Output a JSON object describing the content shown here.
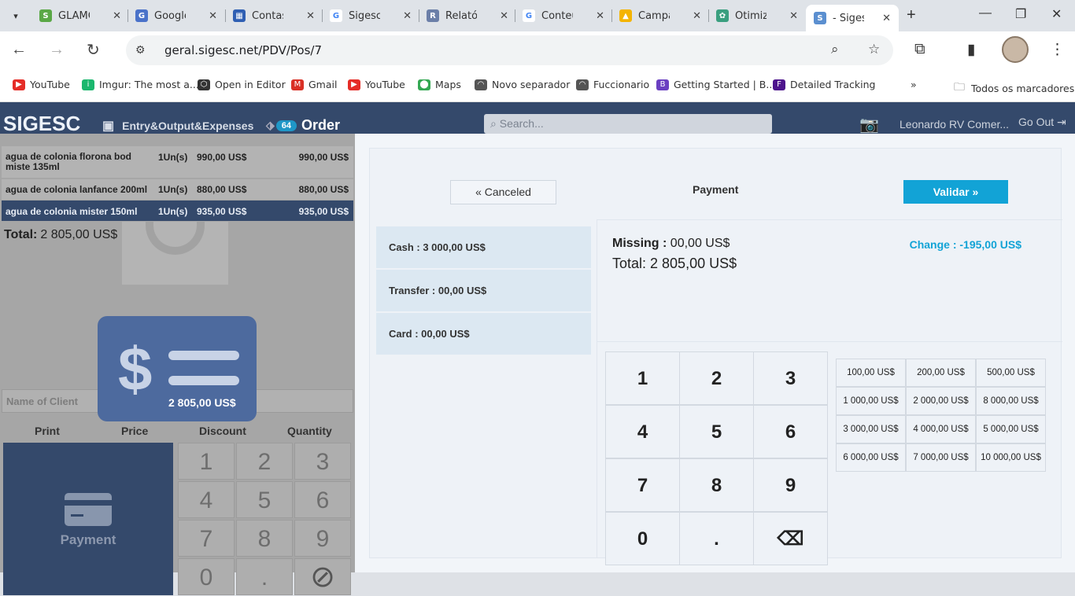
{
  "browser": {
    "tabs": [
      {
        "label": "GLAMO",
        "color": "#5aa846",
        "glyph": "S"
      },
      {
        "label": "Google",
        "color": "#4a72c9",
        "glyph": "G"
      },
      {
        "label": "Contas",
        "color": "#2f5fb3",
        "glyph": "▦"
      },
      {
        "label": "Sigesc",
        "color": "#ffffff",
        "glyph": "G"
      },
      {
        "label": "Relatór",
        "color": "#6b7fa8",
        "glyph": "R"
      },
      {
        "label": "Conteú",
        "color": "#ffffff",
        "glyph": "G"
      },
      {
        "label": "Campa",
        "color": "#f4b400",
        "glyph": "▲"
      },
      {
        "label": "Otimiz",
        "color": "#3a9f7f",
        "glyph": "✿"
      },
      {
        "label": "- Sigesc",
        "color": "#5b8fd0",
        "glyph": "S"
      }
    ],
    "url": "geral.sigesc.net/PDV/Pos/7",
    "bookmarks": [
      {
        "label": "YouTube",
        "color": "#e52d27",
        "glyph": "▶"
      },
      {
        "label": "Imgur: The most a...",
        "color": "#1bb76e",
        "glyph": "i"
      },
      {
        "label": "Open in Editor",
        "color": "#333333",
        "glyph": "⬡"
      },
      {
        "label": "Gmail",
        "color": "#d93025",
        "glyph": "M"
      },
      {
        "label": "YouTube",
        "color": "#e52d27",
        "glyph": "▶"
      },
      {
        "label": "Maps",
        "color": "#34a853",
        "glyph": "⬤"
      },
      {
        "label": "Novo separador",
        "color": "#555555",
        "glyph": "◠"
      },
      {
        "label": "Fuccionario",
        "color": "#555555",
        "glyph": "◠"
      },
      {
        "label": "Getting Started | B...",
        "color": "#6a3fc1",
        "glyph": "B"
      },
      {
        "label": "Detailed Tracking",
        "color": "#4d148c",
        "glyph": "F"
      }
    ],
    "all_bookmarks": "Todos os marcadores"
  },
  "header": {
    "logo": "SIGESC",
    "entry_label": "Entry&Output&Expenses",
    "badge": "64",
    "order_label": "Order",
    "search_placeholder": "Search...",
    "user": "Leonardo RV Comer...",
    "goout": "Go Out"
  },
  "order": {
    "rows": [
      {
        "name": "agua de colonia florona bod miste 135ml",
        "qty": "1Un(s)",
        "price": "990,00 US$",
        "total": "990,00 US$"
      },
      {
        "name": "agua de colonia lanfance 200ml",
        "qty": "1Un(s)",
        "price": "880,00 US$",
        "total": "880,00 US$"
      },
      {
        "name": "agua de colonia mister 150ml",
        "qty": "1Un(s)",
        "price": "935,00 US$",
        "total": "935,00 US$"
      }
    ],
    "total_label": "Total:",
    "total_value": "2 805,00 US$",
    "icon_amount": "2 805,00 US$",
    "client_placeholder": "Name of Client",
    "cols": [
      "Print",
      "Price",
      "Discount",
      "Quantity"
    ],
    "pay_label": "Payment",
    "keys": [
      "1",
      "2",
      "3",
      "4",
      "5",
      "6",
      "7",
      "8",
      "9",
      "0",
      ".",
      "⊘"
    ]
  },
  "modal": {
    "cancel": "« Canceled",
    "title": "Payment",
    "validar": "Validar »",
    "methods": [
      "Cash : 3 000,00 US$",
      "Transfer : 00,00 US$",
      "Card : 00,00 US$"
    ],
    "missing_label": "Missing :",
    "missing_value": "00,00 US$",
    "total": "Total: 2 805,00 US$",
    "change": "Change : -195,00 US$",
    "keys": [
      "1",
      "2",
      "3",
      "4",
      "5",
      "6",
      "7",
      "8",
      "9",
      "0",
      ".",
      "⌫"
    ],
    "quick": [
      "100,00 US$",
      "200,00 US$",
      "500,00 US$",
      "1 000,00 US$",
      "2 000,00 US$",
      "8 000,00 US$",
      "3 000,00 US$",
      "4 000,00 US$",
      "5 000,00 US$",
      "6 000,00 US$",
      "7 000,00 US$",
      "10 000,00 US$"
    ]
  }
}
